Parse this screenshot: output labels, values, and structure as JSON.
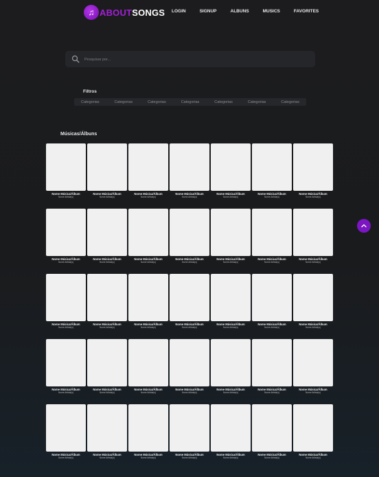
{
  "brand": {
    "about": "ABOUT",
    "songs": "SONGS"
  },
  "nav": [
    "LOGIN",
    "SIGNUP",
    "ALBUNS",
    "MUSICS",
    "FAVORITES"
  ],
  "search": {
    "placeholder": "Pesquisar por..."
  },
  "filters": {
    "title": "Filtros",
    "categories": [
      "Categorias",
      "Categorias",
      "Categorias",
      "Categorias",
      "Categorias",
      "Categorias",
      "Categorias"
    ]
  },
  "section": {
    "title": "Músicas/Álbuns"
  },
  "grid": {
    "rows": 5,
    "columns": 7
  },
  "card": {
    "title": "Nome Música/Álbum",
    "artist": "Nome Artista(s)"
  },
  "colors": {
    "accent": "#a31fd8",
    "button": "#7b16c2",
    "cover": "#f0f0f0"
  },
  "icons": {
    "search": "search-icon",
    "scroll_top": "chevron-up-icon",
    "logo": "music-note-icon"
  }
}
